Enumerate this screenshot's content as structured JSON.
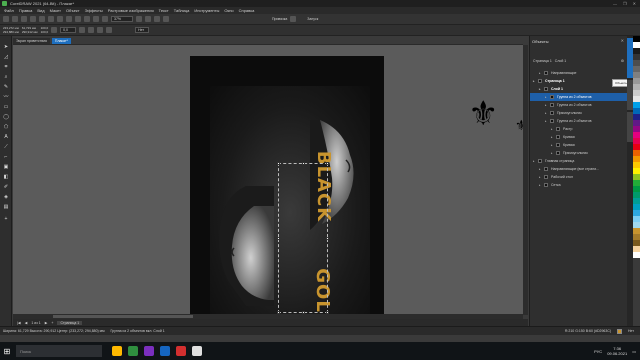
{
  "window": {
    "title": "CorelDRAW 2021 (64-Bit) - Плакат*",
    "controls": [
      "—",
      "❐",
      "✕"
    ]
  },
  "menu": [
    "Файл",
    "Правка",
    "Вид",
    "Макет",
    "Объект",
    "Эффекты",
    "Растровые изображения",
    "Текст",
    "Таблица",
    "Инструменты",
    "Окно",
    "Справка"
  ],
  "toolbar1": {
    "zoom": "37%",
    "snap_label": "Привязка",
    "launch_label": "Запуск"
  },
  "toolbar2": {
    "x": "233,272 мм",
    "y": "294,880 мм",
    "w": "61,729 мм",
    "h": "290,912 мм",
    "sx": "100,0",
    "sy": "100,0",
    "angle": "0,0",
    "outline": "Нет"
  },
  "doc_tabs": [
    {
      "label": "Экран приветствия",
      "active": false
    },
    {
      "label": "Плакат*",
      "active": true
    }
  ],
  "artwork": {
    "word1": "BLACK",
    "word2": "GOLD",
    "fleur": "⚜"
  },
  "page_nav": {
    "counter": "1 из 1",
    "page_label": "Страница 1"
  },
  "docker": {
    "title": "Объекты",
    "page_label": "Страница 1",
    "layer_label": "Слой 1",
    "tree": [
      {
        "label": "Направляющие",
        "level": 1,
        "sel": false,
        "hdr": false
      },
      {
        "label": "Страница 1",
        "level": 0,
        "sel": false,
        "hdr": true
      },
      {
        "label": "Слой 1",
        "level": 1,
        "sel": false,
        "hdr": true
      },
      {
        "label": "Группа из 2 объектов",
        "level": 2,
        "sel": true,
        "hdr": false
      },
      {
        "label": "Группа из 2 объектов",
        "level": 2,
        "sel": false,
        "hdr": false
      },
      {
        "label": "Прямоугольник",
        "level": 2,
        "sel": false,
        "hdr": false
      },
      {
        "label": "Группа из 2 объектов",
        "level": 2,
        "sel": false,
        "hdr": false
      },
      {
        "label": "Растр",
        "level": 3,
        "sel": false,
        "hdr": false
      },
      {
        "label": "Кривая",
        "level": 3,
        "sel": false,
        "hdr": false
      },
      {
        "label": "Кривая",
        "level": 3,
        "sel": false,
        "hdr": false
      },
      {
        "label": "Прямоугольник",
        "level": 3,
        "sel": false,
        "hdr": false
      },
      {
        "label": "Главная страница",
        "level": 0,
        "sel": false,
        "hdr": false
      },
      {
        "label": "Направляющие (все страни...",
        "level": 1,
        "sel": false,
        "hdr": false
      },
      {
        "label": "Рабочий стол",
        "level": 1,
        "sel": false,
        "hdr": false
      },
      {
        "label": "Сетка",
        "level": 1,
        "sel": false,
        "hdr": false
      }
    ],
    "tooltip": "Объекты"
  },
  "palette": [
    "#000000",
    "#ffffff",
    "#1a1a1a",
    "#333333",
    "#4d4d4d",
    "#666666",
    "#808080",
    "#999999",
    "#b3b3b3",
    "#cccccc",
    "#e6e6e6",
    "#00a0e9",
    "#0068b7",
    "#1d2088",
    "#601986",
    "#920783",
    "#e4007f",
    "#e5004f",
    "#e60012",
    "#eb6100",
    "#f39800",
    "#fcc800",
    "#fff100",
    "#8fc31f",
    "#22ac38",
    "#009944",
    "#009b6b",
    "#009e96",
    "#00a0c1",
    "#2ea7e0",
    "#7ecef4",
    "#a0d8ef",
    "#c8942e",
    "#a57b2a",
    "#7a5a1e",
    "#f5d3a0",
    "#ffffff"
  ],
  "status": {
    "dims": "Ширина: 61,729  Высота: 290,912  Центр: (233,272; 294,880) мм",
    "object": "Группа из 2 объектов вкл. Слой 1",
    "fill_info": "R:210 G:150 B:60 (#D2963C)",
    "outline": "Нет"
  },
  "taskbar": {
    "search_placeholder": "Поиск",
    "time": "7:36",
    "date": "09.06.2021",
    "lang": "РУС",
    "icon_colors": [
      "#ffb900",
      "#2f8f3f",
      "#7b2fbf",
      "#1565c0",
      "#d32f2f",
      "#e0e0e0"
    ]
  }
}
